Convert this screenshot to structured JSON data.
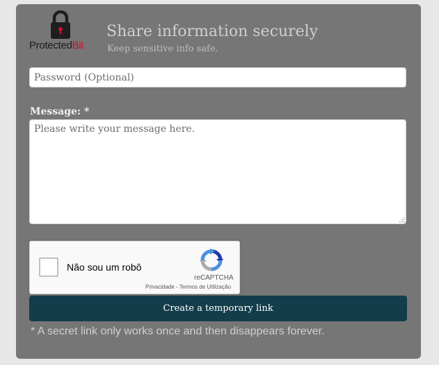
{
  "logo": {
    "text_main": "Protected",
    "text_accent": "Bit",
    "icon": "lock-icon",
    "accent_color": "#c8102e"
  },
  "header": {
    "title": "Share information securely",
    "subtitle": "Keep sensitive info safe."
  },
  "form": {
    "password_placeholder": "Password (Optional)",
    "password_value": "",
    "message_label": "Message: *",
    "message_placeholder": "Please write your message here.",
    "message_value": ""
  },
  "captcha": {
    "label": "Não sou um robô",
    "brand": "reCAPTCHA",
    "privacy_link": "Privacidade",
    "separator": " - ",
    "terms_link": "Termos de Utilização",
    "checked": false,
    "icon": "recaptcha-icon"
  },
  "actions": {
    "create_label": "Create a temporary link",
    "button_color": "#123d4a"
  },
  "footer": {
    "note": "* A secret link only works once and then disappears forever."
  }
}
